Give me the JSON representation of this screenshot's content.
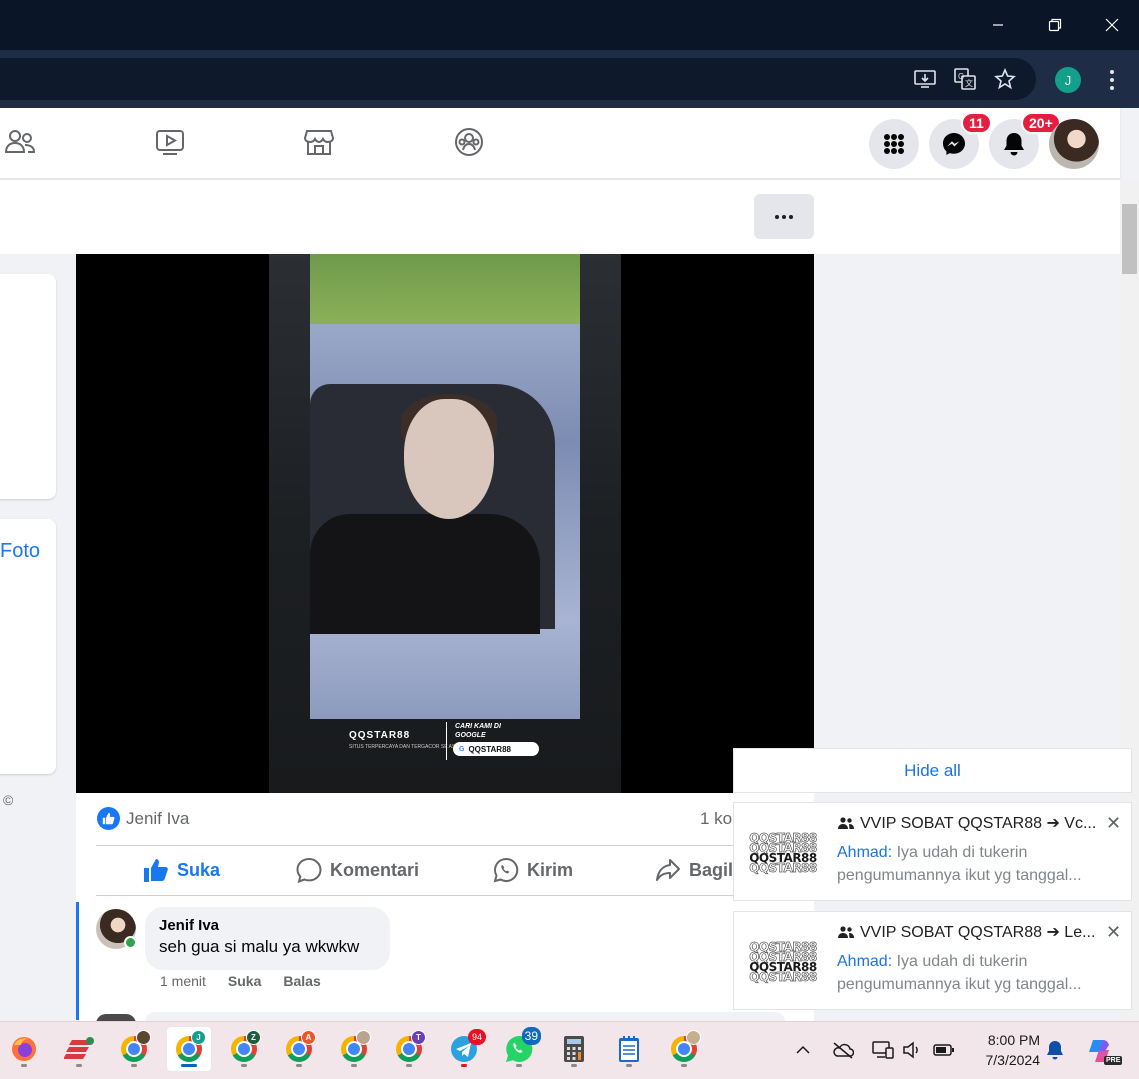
{
  "window": {
    "minimize_label": "",
    "restore_label": "",
    "close_label": ""
  },
  "browser": {
    "profile_initial": "J"
  },
  "fb_header": {
    "messenger_badge": "11",
    "notifications_badge": "20+"
  },
  "left_column": {
    "foto_text": "Foto",
    "copyright": "©"
  },
  "video_overlay": {
    "brand": "QQSTAR88",
    "tagline": "SITUS TERPERCAYA DAN TERGACOR SE ASIA",
    "cari_kami": "CARI KAMI DI GOOGLE",
    "search_term": "QQSTAR88"
  },
  "post": {
    "reactor_name": "Jenif Iva",
    "comment_count": "1 ko",
    "actions": {
      "like": "Suka",
      "comment": "Komentari",
      "send": "Kirim",
      "share": "Bagil"
    }
  },
  "comment": {
    "author": "Jenif Iva",
    "text": "seh gua si malu ya wkwkw",
    "time": "1 menit",
    "like": "Suka",
    "reply": "Balas"
  },
  "notifications": {
    "hide_all": "Hide all",
    "items": [
      {
        "logo_text": "QQSTAR88",
        "title": "VVIP SOBAT QQSTAR88 ➔ Vc...",
        "sender": "Ahmad:",
        "message": "Iya udah di tukerin pengumumannya ikut yg tanggal..."
      },
      {
        "logo_text": "QQSTAR88",
        "title": "VVIP SOBAT QQSTAR88 ➔ Le...",
        "sender": "Ahmad:",
        "message": "Iya udah di tukerin pengumumannya ikut yg tanggal..."
      }
    ]
  },
  "taskbar": {
    "apps": [
      "firefox",
      "expressvpn",
      "chrome-profile-1",
      "chrome-profile-J",
      "chrome-profile-Z",
      "chrome-profile-A",
      "chrome-profile-5",
      "chrome-profile-T",
      "telegram",
      "whatsapp",
      "calculator",
      "notepad",
      "chrome-profile-9"
    ],
    "profile_letters": {
      "j": "J",
      "z": "Z",
      "a": "A",
      "t": "T"
    },
    "telegram_badge": "94",
    "whatsapp_badge": "39",
    "time": "8:00 PM",
    "date": "7/3/2024",
    "copilot_label": "PRE"
  },
  "colors": {
    "fb_blue": "#1877f2",
    "badge_red": "#e41e3f",
    "titlebar": "#0a1628",
    "taskbar": "#f3e6ea"
  }
}
